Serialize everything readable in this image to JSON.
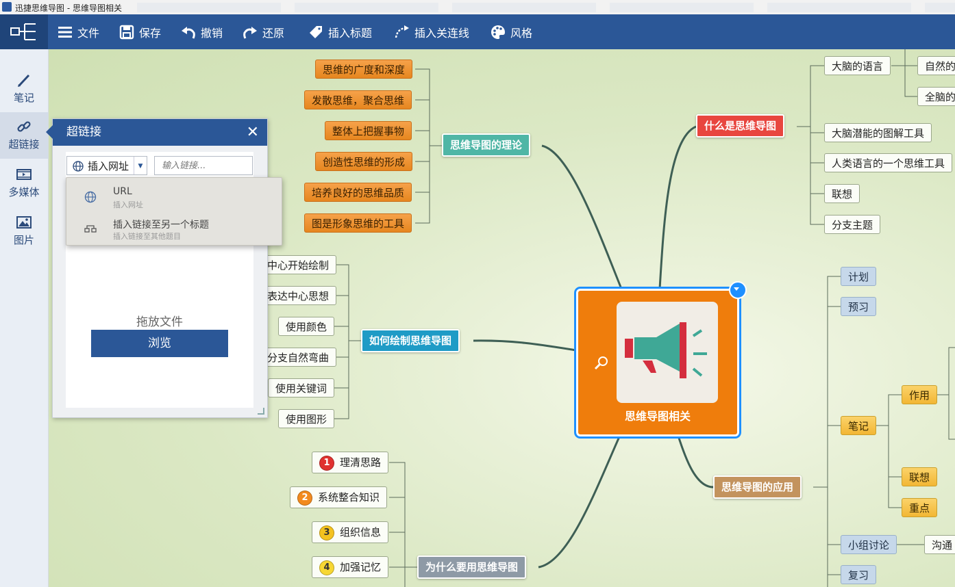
{
  "window": {
    "title": "迅捷思维导图 - 思维导图相关"
  },
  "toolbar": {
    "file": "文件",
    "save": "保存",
    "undo": "撤销",
    "redo": "还原",
    "insert_topic": "插入标题",
    "insert_relation": "插入关连线",
    "style": "风格"
  },
  "sidebar": {
    "items": [
      {
        "label": "笔记",
        "icon": "pencil-icon"
      },
      {
        "label": "超链接",
        "icon": "link-icon"
      },
      {
        "label": "多媒体",
        "icon": "film-icon"
      },
      {
        "label": "图片",
        "icon": "image-icon"
      }
    ]
  },
  "hyperlink_panel": {
    "title": "超链接",
    "type_select": "插入网址",
    "url_placeholder": "输入链接...",
    "dropdown": [
      {
        "title": "URL",
        "subtitle": "插入网址"
      },
      {
        "title": "插入链接至另一个标题",
        "subtitle": "插入链接至其他题目"
      }
    ],
    "drop_text": "拖放文件",
    "browse": "浏览"
  },
  "mindmap": {
    "central": "思维导图相关",
    "theory": {
      "label": "思维导图的理论",
      "children": [
        "思维的广度和深度",
        "发散思维，聚合思维",
        "整体上把握事物",
        "创造性思维的形成",
        "培养良好的思维品质",
        "图是形象思维的工具"
      ]
    },
    "howto": {
      "label": "如何绘制思维导图",
      "children": [
        "中心开始绘制",
        "表达中心思想",
        "使用颜色",
        "分支自然弯曲",
        "使用关键词",
        "使用图形"
      ]
    },
    "why": {
      "label": "为什么要用思维导图",
      "children": [
        "理清思路",
        "系统整合知识",
        "组织信息",
        "加强记忆"
      ],
      "badges": [
        "1",
        "2",
        "3",
        "4"
      ]
    },
    "what": {
      "label": "什么是思维导图",
      "children": [
        "大脑的语言",
        "大脑潜能的图解工具",
        "人类语言的一个思维工具",
        "联想",
        "分支主题"
      ],
      "sub": [
        "自然的",
        "全脑的"
      ]
    },
    "apply": {
      "label": "思维导图的应用",
      "children": [
        "计划",
        "预习",
        "笔记",
        "小组讨论",
        "复习"
      ],
      "note_children": [
        "作用",
        "联想",
        "重点"
      ],
      "discuss_child": "沟通"
    }
  }
}
